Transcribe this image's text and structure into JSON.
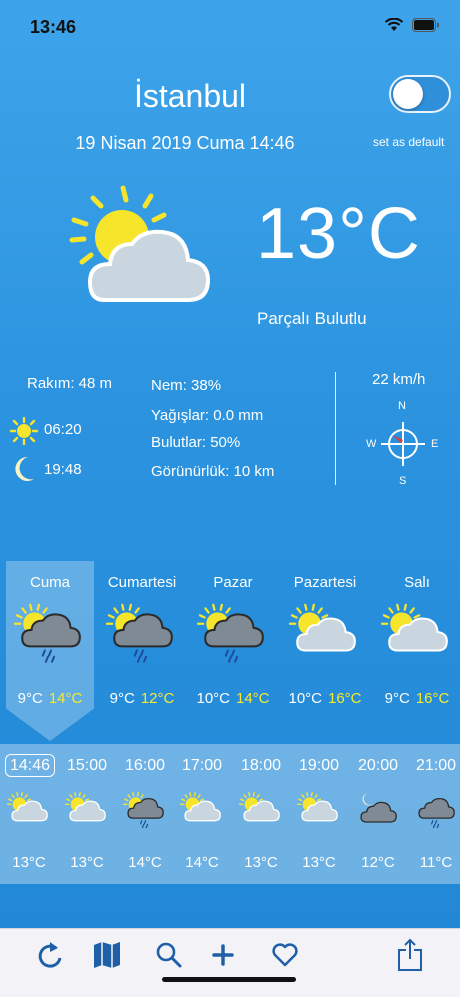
{
  "status": {
    "time": "13:46"
  },
  "header": {
    "city": "İstanbul",
    "date": "19 Nisan 2019 Cuma 14:46",
    "default_label": "set as default"
  },
  "current": {
    "temp": "13°C",
    "condition": "Parçalı Bulutlu"
  },
  "details": {
    "altitude": "Rakım: 48 m",
    "sunrise": "06:20",
    "sunset": "19:48",
    "humidity": "Nem: 38%",
    "precip": "Yağışlar: 0.0 mm",
    "clouds": "Bulutlar: 50%",
    "visibility": "Görünürlük: 10 km",
    "wind_speed": "22 km/h",
    "compass": {
      "n": "N",
      "s": "S",
      "e": "E",
      "w": "W"
    }
  },
  "daily": [
    {
      "name": "Cuma",
      "lo": "9°C",
      "hi": "14°C",
      "icon": "sun-cloud-rain-icon"
    },
    {
      "name": "Cumartesi",
      "lo": "9°C",
      "hi": "12°C",
      "icon": "sun-cloud-rain-icon"
    },
    {
      "name": "Pazar",
      "lo": "10°C",
      "hi": "14°C",
      "icon": "sun-cloud-rain-icon"
    },
    {
      "name": "Pazartesi",
      "lo": "10°C",
      "hi": "16°C",
      "icon": "partly-cloudy-icon"
    },
    {
      "name": "Salı",
      "lo": "9°C",
      "hi": "16°C",
      "icon": "partly-cloudy-icon"
    }
  ],
  "hourly": [
    {
      "time": "14:46",
      "temp": "13°C",
      "icon": "partly-cloudy-icon"
    },
    {
      "time": "15:00",
      "temp": "13°C",
      "icon": "partly-cloudy-icon"
    },
    {
      "time": "16:00",
      "temp": "14°C",
      "icon": "sun-cloud-rain-icon"
    },
    {
      "time": "17:00",
      "temp": "14°C",
      "icon": "partly-cloudy-icon"
    },
    {
      "time": "18:00",
      "temp": "13°C",
      "icon": "partly-cloudy-icon"
    },
    {
      "time": "19:00",
      "temp": "13°C",
      "icon": "partly-cloudy-icon"
    },
    {
      "time": "20:00",
      "temp": "12°C",
      "icon": "moon-cloud-icon"
    },
    {
      "time": "21:00",
      "temp": "11°C",
      "icon": "cloud-rain-icon"
    }
  ],
  "tabbar": [
    "refresh-icon",
    "map-icon",
    "search-icon",
    "plus-icon",
    "heart-icon",
    "share-icon"
  ]
}
